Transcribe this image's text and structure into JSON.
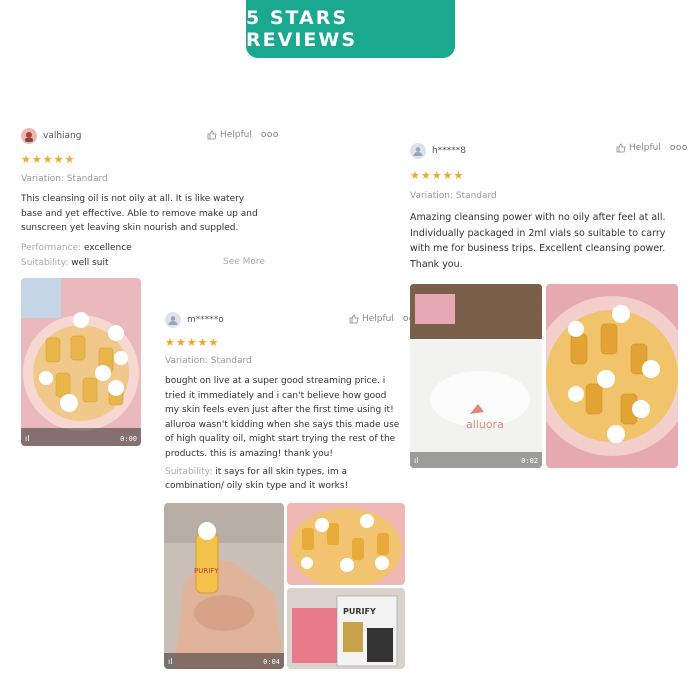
{
  "banner": {
    "title": "5 STARS REVIEWS"
  },
  "reviews": [
    {
      "username": "valhiang",
      "helpful_label": "Helpful",
      "more": "ooo",
      "stars": "★★★★★",
      "rating": 5,
      "variation": "Variation: Standard",
      "text": "This cleansing oil is not oily at all. It is like watery base and yet effective. Able to remove make up and sunscreen yet leaving skin nourish and suppled.",
      "performance_key": "Performance:",
      "performance_val": "excellence",
      "suitability_key": "Suitability:",
      "suitability_val": "well suit",
      "see_more": "See More",
      "media": [
        {
          "type": "video",
          "duration": "0:00"
        }
      ]
    },
    {
      "username": "m*****o",
      "helpful_label": "Helpful",
      "more": "oo",
      "stars": "★★★★★",
      "rating": 5,
      "variation": "Variation: Standard",
      "text": "bought on live at a super good streaming price. i tried it immediately and i can't believe how good my skin feels even just after the first time using it! alluroa wasn't kidding when she says this made use of high quality oil, might start trying the rest of the products. this is amazing! thank you!",
      "suitability_key": "Suitability:",
      "suitability_val": "it says for all skin types, im a combination/ oily skin type and it works!",
      "media": [
        {
          "type": "video",
          "duration": "0:04"
        },
        {
          "type": "image"
        },
        {
          "type": "image"
        }
      ]
    },
    {
      "username": "h*****8",
      "helpful_label": "Helpful",
      "more": "ooo",
      "stars": "★★★★★",
      "rating": 5,
      "variation": "Variation: Standard",
      "text": "Amazing cleansing power with no oily after feel at all. Individually packaged in 2ml vials so suitable to carry with me for business trips. Excellent cleansing power. Thank you.",
      "media": [
        {
          "type": "video",
          "duration": "0:02",
          "brand": "alluora"
        },
        {
          "type": "image"
        }
      ]
    }
  ]
}
